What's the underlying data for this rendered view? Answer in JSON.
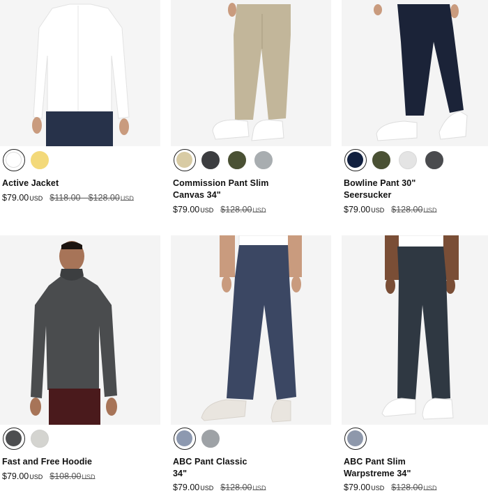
{
  "products": [
    {
      "name": "Active Jacket",
      "price": "$79.00",
      "currency": "USD",
      "was": "$118.00 - $128.00",
      "was_currency": "USD",
      "swatches": [
        "#ffffff",
        "#f3d97a"
      ],
      "image_icon": "white-jacket-photo"
    },
    {
      "name": "Commission Pant Slim\nCanvas 34\"",
      "price": "$79.00",
      "currency": "USD",
      "was": "$128.00",
      "was_currency": "USD",
      "swatches": [
        "#d8cba4",
        "#3c3d40",
        "#4a5134",
        "#a8adb0"
      ],
      "image_icon": "khaki-pants-photo"
    },
    {
      "name": "Bowline Pant 30\"\nSeersucker",
      "price": "$79.00",
      "currency": "USD",
      "was": "$128.00",
      "was_currency": "USD",
      "swatches": [
        "#11203f",
        "#4a5134",
        "#e4e4e4",
        "#4a4b4e"
      ],
      "image_icon": "navy-pants-photo"
    },
    {
      "name": "Fast and Free Hoodie",
      "price": "$79.00",
      "currency": "USD",
      "was": "$108.00",
      "was_currency": "USD",
      "swatches": [
        "#4d4e50",
        "#d4d4d0"
      ],
      "image_icon": "grey-hoodie-photo"
    },
    {
      "name": "ABC Pant Classic\n34\"",
      "price": "$79.00",
      "currency": "USD",
      "was": "$128.00",
      "was_currency": "USD",
      "swatches": [
        "#8d99b0",
        "#9ea2a6"
      ],
      "image_icon": "blue-pants-photo"
    },
    {
      "name": "ABC Pant Slim\nWarpstreme 34\"",
      "price": "$79.00",
      "currency": "USD",
      "was": "$128.00",
      "was_currency": "USD",
      "swatches": [
        "#8e98ab"
      ],
      "image_icon": "dark-pants-photo"
    }
  ]
}
